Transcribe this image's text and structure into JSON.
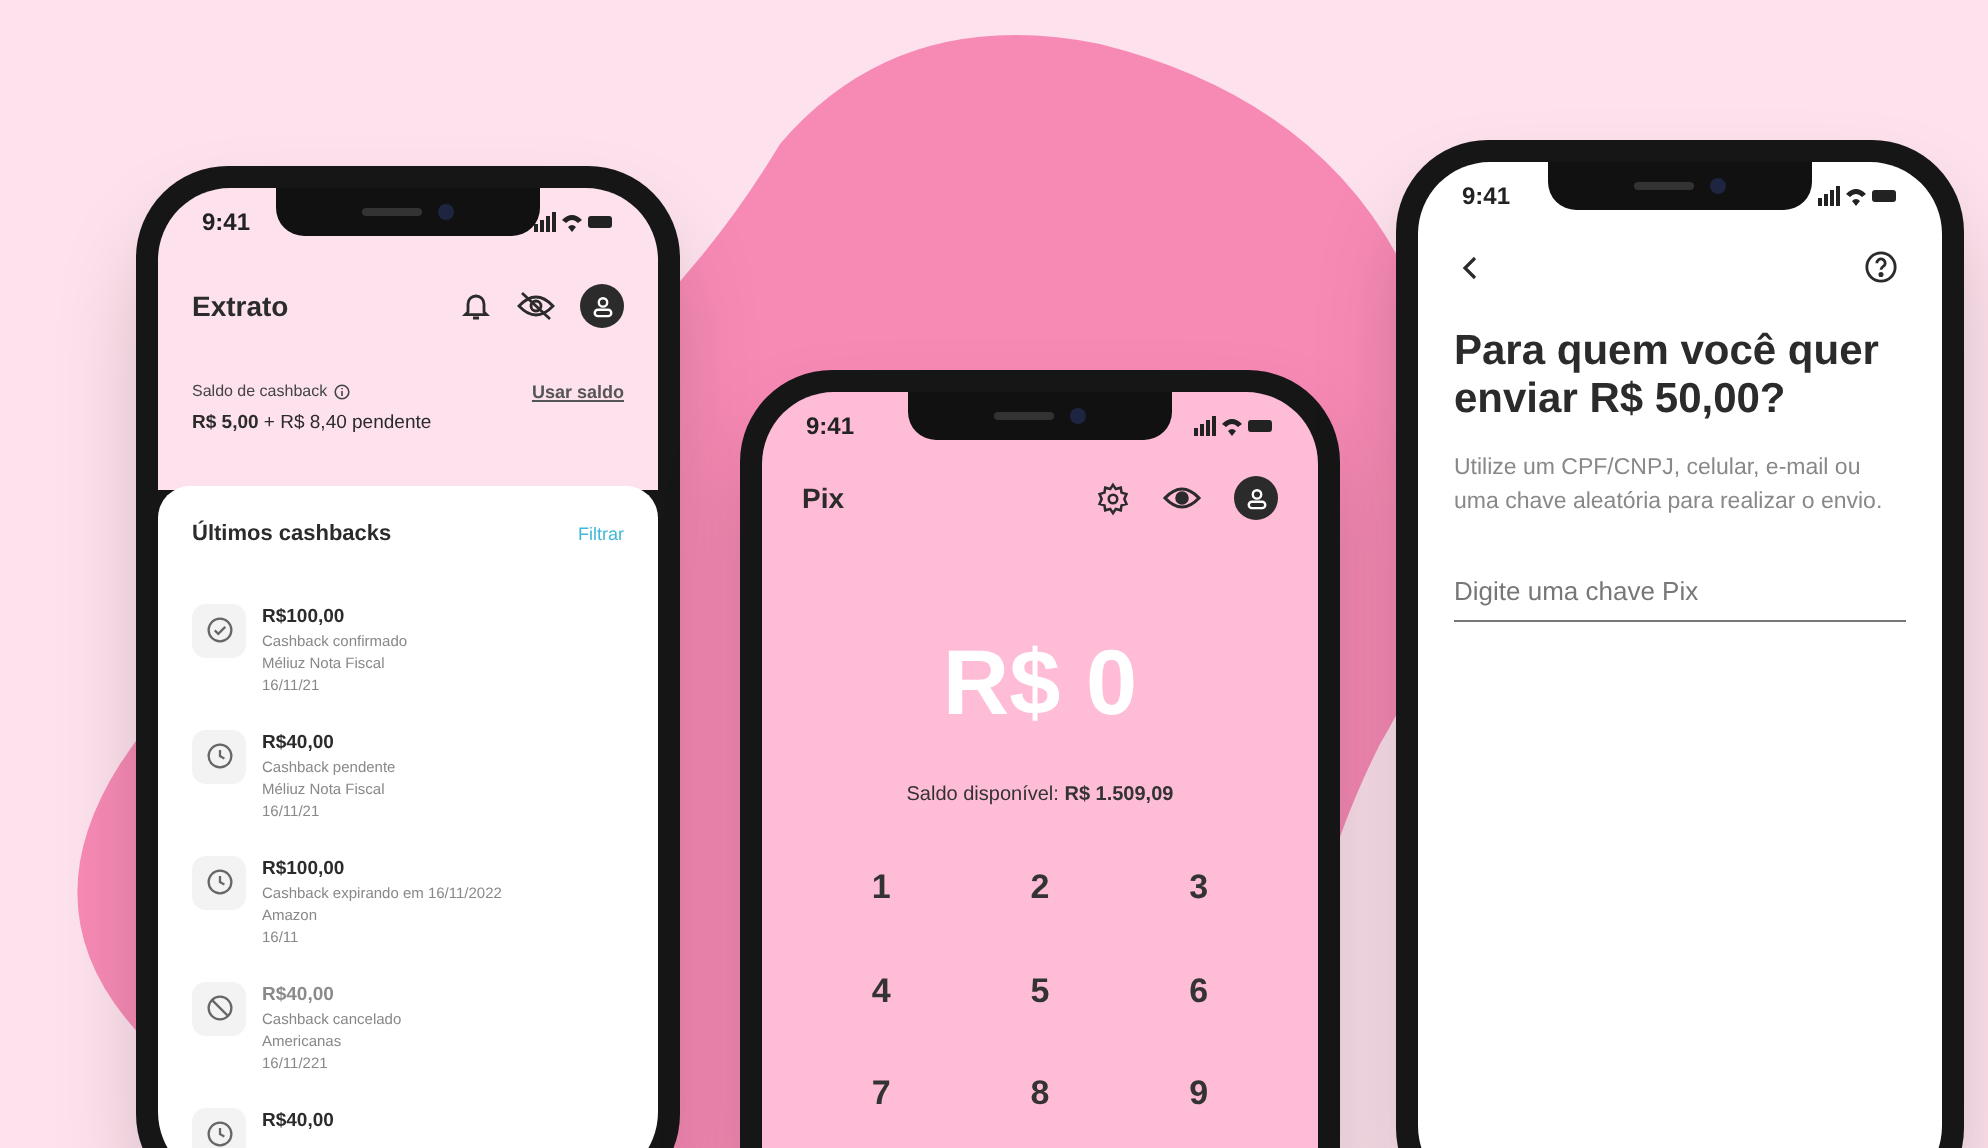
{
  "statement_screen": {
    "time": "9:41",
    "title": "Extrato",
    "balance_label": "Saldo de cashback",
    "balance_value": "**R$ 5,00** + R$ 8,40 pendente",
    "use_balance_link": "Usar saldo",
    "list_title": "Últimos cashbacks",
    "filter_link": "Filtrar",
    "items": [
      {
        "kind": "confirmed",
        "amount": "R$100,00",
        "status": "Cashback confirmado",
        "store": "Méliuz Nota Fiscal",
        "date": "16/11/21"
      },
      {
        "kind": "pending",
        "amount": "R$40,00",
        "status": "Cashback pendente",
        "store": "Méliuz Nota Fiscal",
        "date": "16/11/21"
      },
      {
        "kind": "pending",
        "amount": "R$100,00",
        "status": "Cashback expirando em 16/11/2022",
        "store": "Amazon",
        "date": "16/11"
      },
      {
        "kind": "cancelled",
        "amount": "R$40,00",
        "status": "Cashback cancelado",
        "store": "Americanas",
        "date": "16/11/221"
      },
      {
        "kind": "pending",
        "amount": "R$40,00"
      }
    ]
  },
  "pix_screen": {
    "time": "9:41",
    "title": "Pix",
    "amount": "R$ 0",
    "available_balance": "Saldo disponível: **R$ 1.509,09**",
    "keypad": [
      "1",
      "2",
      "3",
      "4",
      "5",
      "6",
      "7",
      "8",
      "9"
    ]
  },
  "send_screen": {
    "time": "9:41",
    "title": "Para quem você quer enviar R$ 50,00?",
    "description": "Utilize um CPF/CNPJ, celular, e-mail ou uma chave aleatória para realizar o envio.",
    "key_field": {
      "placeholder": "Digite uma chave Pix"
    }
  }
}
